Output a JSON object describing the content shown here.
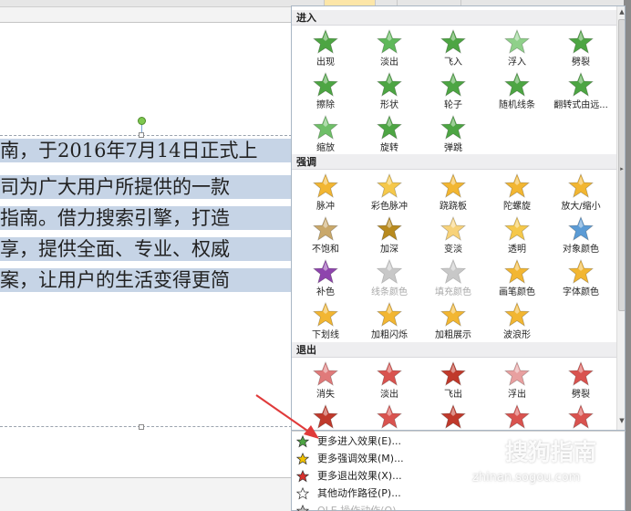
{
  "document": {
    "text_lines": [
      "南，于2016年7月14日正式上",
      "司为广大用户所提供的一款",
      "指南。借力搜索引擎，打造",
      "享，提供全面、专业、权威",
      "案，让用户的生活变得更简"
    ]
  },
  "gallery": {
    "sections": [
      {
        "title": "进入",
        "items": [
          {
            "label": "出现",
            "color": "#4da543",
            "icon": "star-appear-icon",
            "disabled": false
          },
          {
            "label": "淡出",
            "color": "#5fb85a",
            "icon": "star-fade-icon",
            "disabled": false
          },
          {
            "label": "飞入",
            "color": "#4da543",
            "icon": "star-fly-in-icon",
            "disabled": false
          },
          {
            "label": "浮入",
            "color": "#8fd08a",
            "icon": "star-float-in-icon",
            "disabled": false
          },
          {
            "label": "劈裂",
            "color": "#4da543",
            "icon": "star-split-icon",
            "disabled": false
          },
          {
            "label": "擦除",
            "color": "#4da543",
            "icon": "star-wipe-icon",
            "disabled": false
          },
          {
            "label": "形状",
            "color": "#4da543",
            "icon": "star-shape-icon",
            "disabled": false
          },
          {
            "label": "轮子",
            "color": "#4da543",
            "icon": "star-wheel-icon",
            "disabled": false
          },
          {
            "label": "随机线条",
            "color": "#4da543",
            "icon": "star-random-bars-icon",
            "disabled": false
          },
          {
            "label": "翻转式由远...",
            "color": "#4da543",
            "icon": "star-grow-turn-icon",
            "disabled": false
          },
          {
            "label": "缩放",
            "color": "#6fbf68",
            "icon": "star-zoom-icon",
            "disabled": false
          },
          {
            "label": "旋转",
            "color": "#4da543",
            "icon": "star-swivel-icon",
            "disabled": false
          },
          {
            "label": "弹跳",
            "color": "#4da543",
            "icon": "star-bounce-icon",
            "disabled": false
          }
        ]
      },
      {
        "title": "强调",
        "items": [
          {
            "label": "脉冲",
            "color": "#f2b632",
            "icon": "star-pulse-icon",
            "disabled": false
          },
          {
            "label": "彩色脉冲",
            "color": "#f5c84a",
            "icon": "star-color-pulse-icon",
            "disabled": false
          },
          {
            "label": "跷跷板",
            "color": "#f2b632",
            "icon": "star-teeter-icon",
            "disabled": false
          },
          {
            "label": "陀螺旋",
            "color": "#f2b632",
            "icon": "star-spin-icon",
            "disabled": false
          },
          {
            "label": "放大/缩小",
            "color": "#f2b632",
            "icon": "star-grow-shrink-icon",
            "disabled": false
          },
          {
            "label": "不饱和",
            "color": "#c9a86a",
            "icon": "star-desaturate-icon",
            "disabled": false
          },
          {
            "label": "加深",
            "color": "#b88a1e",
            "icon": "star-darken-icon",
            "disabled": false
          },
          {
            "label": "变淡",
            "color": "#f7d27a",
            "icon": "star-lighten-icon",
            "disabled": false
          },
          {
            "label": "透明",
            "color": "#f5c84a",
            "icon": "star-transparency-icon",
            "disabled": false
          },
          {
            "label": "对象颜色",
            "color": "#5b9bd5",
            "icon": "star-object-color-icon",
            "disabled": false
          },
          {
            "label": "补色",
            "color": "#8e44ad",
            "icon": "star-complementary-icon",
            "disabled": false
          },
          {
            "label": "线条颜色",
            "color": "#c8c8c8",
            "icon": "star-line-color-icon",
            "disabled": true
          },
          {
            "label": "填充颜色",
            "color": "#c8c8c8",
            "icon": "star-fill-color-icon",
            "disabled": true
          },
          {
            "label": "画笔颜色",
            "color": "#f2b632",
            "icon": "star-brush-color-icon",
            "disabled": false
          },
          {
            "label": "字体颜色",
            "color": "#f2b632",
            "icon": "star-font-color-icon",
            "disabled": false
          },
          {
            "label": "下划线",
            "color": "#f2b632",
            "icon": "star-underline-icon",
            "disabled": false
          },
          {
            "label": "加粗闪烁",
            "color": "#f2b632",
            "icon": "star-bold-flash-icon",
            "disabled": false
          },
          {
            "label": "加粗展示",
            "color": "#f2b632",
            "icon": "star-bold-reveal-icon",
            "disabled": false
          },
          {
            "label": "波浪形",
            "color": "#f2b632",
            "icon": "star-wave-icon",
            "disabled": false
          }
        ]
      },
      {
        "title": "退出",
        "items": [
          {
            "label": "消失",
            "color": "#e07a7a",
            "icon": "star-disappear-icon",
            "disabled": false
          },
          {
            "label": "淡出",
            "color": "#d9534f",
            "icon": "star-fade-out-icon",
            "disabled": false
          },
          {
            "label": "飞出",
            "color": "#c0392b",
            "icon": "star-fly-out-icon",
            "disabled": false
          },
          {
            "label": "浮出",
            "color": "#e8a0a0",
            "icon": "star-float-out-icon",
            "disabled": false
          },
          {
            "label": "劈裂",
            "color": "#d9534f",
            "icon": "star-split-out-icon",
            "disabled": false
          },
          {
            "label": "",
            "color": "#c0392b",
            "icon": "star-exit-6-icon",
            "disabled": false
          },
          {
            "label": "",
            "color": "#d9534f",
            "icon": "star-exit-7-icon",
            "disabled": false
          },
          {
            "label": "",
            "color": "#c0392b",
            "icon": "star-exit-8-icon",
            "disabled": false
          },
          {
            "label": "",
            "color": "#d9534f",
            "icon": "star-exit-9-icon",
            "disabled": false
          },
          {
            "label": "",
            "color": "#d9534f",
            "icon": "star-exit-10-icon",
            "disabled": false
          }
        ]
      }
    ]
  },
  "menu": {
    "items": [
      {
        "label": "更多进入效果(E)...",
        "icon": "green-star-icon",
        "color": "#4da543",
        "disabled": false
      },
      {
        "label": "更多强调效果(M)...",
        "icon": "yellow-star-icon",
        "color": "#f2c200",
        "disabled": false
      },
      {
        "label": "更多退出效果(X)...",
        "icon": "red-star-icon",
        "color": "#d9302c",
        "disabled": false
      },
      {
        "label": "其他动作路径(P)...",
        "icon": "outline-star-icon",
        "color": "#ffffff",
        "disabled": false
      },
      {
        "label": "OLE 操作动作(O)...",
        "icon": "ole-action-icon",
        "color": "#bbbbbb",
        "disabled": true
      }
    ]
  },
  "watermark": {
    "text": "搜狗指南",
    "url": "zhinan.sogou.com"
  }
}
